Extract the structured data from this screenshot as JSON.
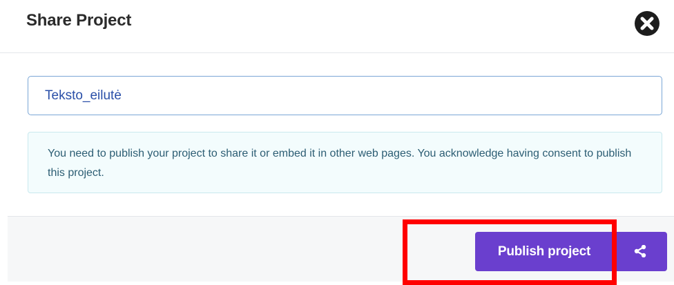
{
  "dialog": {
    "title": "Share Project",
    "close_icon": "close-circle-icon"
  },
  "project_name": {
    "value": "Teksto_eilutė",
    "placeholder": ""
  },
  "notice": {
    "text": "You need to publish your project to share it or embed it in other web pages. You acknowledge having consent to publish this project."
  },
  "footer": {
    "publish_label": "Publish project",
    "share_icon": "share-icon"
  },
  "colors": {
    "accent": "#6a3fce",
    "highlight": "#ff0000",
    "notice_bg": "#f3fcfd",
    "notice_text": "#2c5d73"
  }
}
